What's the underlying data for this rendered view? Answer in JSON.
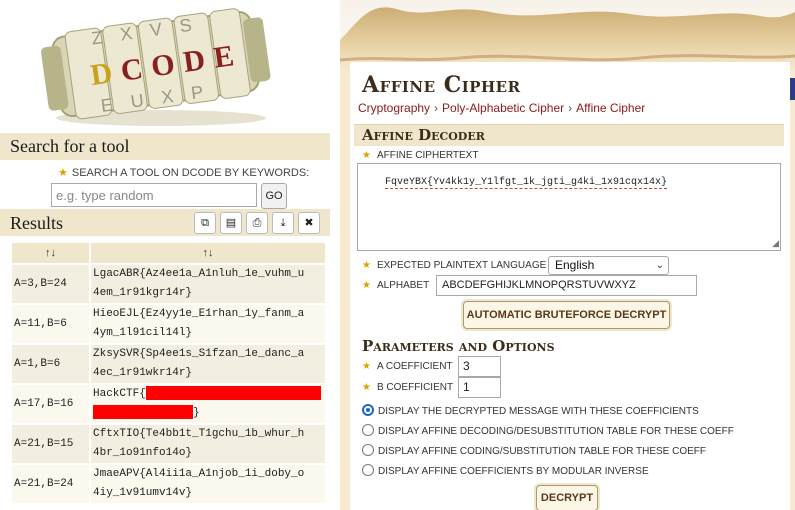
{
  "logo": {
    "text": "DCODE",
    "top_letters": [
      "Z",
      "X",
      "V",
      "S"
    ],
    "bottom_letters": [
      "E",
      "U",
      "X",
      "P"
    ]
  },
  "search": {
    "heading": "Search for a tool",
    "label": "SEARCH A TOOL ON DCODE BY KEYWORDS:",
    "placeholder": "e.g. type random",
    "go": "GO"
  },
  "results": {
    "heading": "Results",
    "columns": [
      "↑↓",
      "↑↓"
    ],
    "rows": [
      {
        "key": "A=3,B=24",
        "line1": "LgacABR{Az4ee1a_A1nluh_1e_vuhm_u",
        "line2": "4em_1r91kgr14r}"
      },
      {
        "key": "A=11,B=6",
        "line1": "HieoEJL{Ez4yy1e_E1rhan_1y_fanm_a",
        "line2": "4ym_1l91cil14l}"
      },
      {
        "key": "A=1,B=6",
        "line1": "ZksySVR{Sp4ee1s_S1fzan_1e_danc_a",
        "line2": "4ec_1r91wkr14r}"
      },
      {
        "key": "A=17,B=16",
        "line1": "HackCTF{",
        "line2": "}",
        "redacted": true
      },
      {
        "key": "A=21,B=15",
        "line1": "CftxTIO{Te4bb1t_T1gchu_1b_whur_h",
        "line2": "4br_1o91nfo14o}"
      },
      {
        "key": "A=21,B=24",
        "line1": "JmaeAPV{Al4ii1a_A1njob_1i_doby_o",
        "line2": "4iy_1v91umv14v}"
      }
    ]
  },
  "header": {
    "title": "Affine Cipher",
    "breadcrumb": [
      "Cryptography",
      "Poly-Alphabetic Cipher",
      "Affine Cipher"
    ]
  },
  "decoder": {
    "heading": "Affine Decoder",
    "ciphertext_label": "AFFINE CIPHERTEXT",
    "ciphertext": "FqveYBX{Yv4kk1y_Y1lfgt_1k_jgti_g4ki_1x91cqx14x}",
    "language_label": "EXPECTED PLAINTEXT LANGUAGE",
    "language": "English",
    "alphabet_label": "ALPHABET",
    "alphabet": "ABCDEFGHIJKLMNOPQRSTUVWXYZ",
    "bruteforce_button": "AUTOMATIC BRUTEFORCE DECRYPT"
  },
  "params": {
    "heading": "Parameters and Options",
    "a_label": "A COEFFICIENT",
    "a_value": "3",
    "b_label": "B COEFFICIENT",
    "b_value": "1",
    "options": [
      {
        "label": "DISPLAY THE DECRYPTED MESSAGE WITH THESE COEFFICIENTS",
        "selected": true
      },
      {
        "label": "DISPLAY AFFINE DECODING/DESUBSTITUTION TABLE FOR THESE COEFF",
        "selected": false
      },
      {
        "label": "DISPLAY AFFINE CODING/SUBSTITUTION TABLE FOR THESE COEFF",
        "selected": false
      },
      {
        "label": "DISPLAY AFFINE COEFFICIENTS BY MODULAR INVERSE",
        "selected": false
      }
    ],
    "decrypt_button": "DECRYPT"
  },
  "colors": {
    "accent_red": "#8b1a1a",
    "section_bg": "#efe6cc",
    "redaction": "#ff0000"
  }
}
